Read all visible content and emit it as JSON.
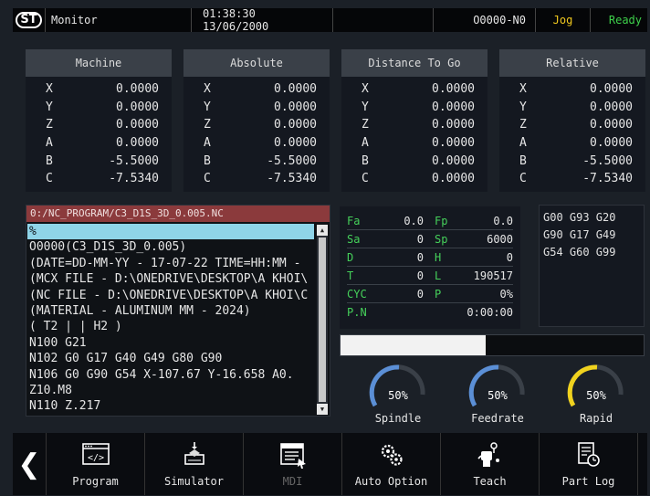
{
  "topbar": {
    "logo": "ST",
    "title": "Monitor",
    "datetime": "01:38:30 13/06/2000",
    "program_no": "O0000-N0",
    "mode": "Jog",
    "status": "Ready"
  },
  "coords": [
    {
      "title": "Machine",
      "rows": [
        [
          "X",
          "0.0000"
        ],
        [
          "Y",
          "0.0000"
        ],
        [
          "Z",
          "0.0000"
        ],
        [
          "A",
          "0.0000"
        ],
        [
          "B",
          "-5.5000"
        ],
        [
          "C",
          "-7.5340"
        ]
      ]
    },
    {
      "title": "Absolute",
      "rows": [
        [
          "X",
          "0.0000"
        ],
        [
          "Y",
          "0.0000"
        ],
        [
          "Z",
          "0.0000"
        ],
        [
          "A",
          "0.0000"
        ],
        [
          "B",
          "-5.5000"
        ],
        [
          "C",
          "-7.5340"
        ]
      ]
    },
    {
      "title": "Distance To Go",
      "rows": [
        [
          "X",
          "0.0000"
        ],
        [
          "Y",
          "0.0000"
        ],
        [
          "Z",
          "0.0000"
        ],
        [
          "A",
          "0.0000"
        ],
        [
          "B",
          "0.0000"
        ],
        [
          "C",
          "0.0000"
        ]
      ]
    },
    {
      "title": "Relative",
      "rows": [
        [
          "X",
          "0.0000"
        ],
        [
          "Y",
          "0.0000"
        ],
        [
          "Z",
          "0.0000"
        ],
        [
          "A",
          "0.0000"
        ],
        [
          "B",
          "-5.5000"
        ],
        [
          "C",
          "-7.5340"
        ]
      ]
    }
  ],
  "program": {
    "path": "0:/NC_PROGRAM/C3_D1S_3D_0.005.NC",
    "lines": [
      "%",
      "O0000(C3_D1S_3D_0.005)",
      "(DATE=DD-MM-YY - 17-07-22 TIME=HH:MM -",
      "(MCX FILE - D:\\ONEDRIVE\\DESKTOP\\A KHOI\\",
      "(NC FILE - D:\\ONEDRIVE\\DESKTOP\\A KHOI\\C",
      "(MATERIAL - ALUMINUM MM - 2024)",
      "( T2 | | H2 )",
      "N100 G21",
      "N102 G0 G17 G40 G49 G80 G90",
      "N106 G0 G90 G54 X-107.67 Y-16.658 A0.",
      "Z10.M8",
      "N110 Z.217"
    ]
  },
  "feed": {
    "rows": [
      {
        "k": "Fa",
        "v": "0.0",
        "k2": "Fp",
        "v2": "0.0"
      },
      {
        "k": "Sa",
        "v": "0",
        "k2": "Sp",
        "v2": "6000"
      },
      {
        "k": "D",
        "v": "0",
        "k2": "H",
        "v2": "0"
      },
      {
        "k": "T",
        "v": "0",
        "k2": "L",
        "v2": "190517"
      },
      {
        "k": "CYC",
        "v": "0",
        "k2": "P",
        "v2": "0%"
      }
    ],
    "pn_label": "P.N",
    "pn_value": "0:00:00"
  },
  "modal": {
    "lines": [
      "G00 G93 G20",
      "G90 G17 G49",
      "G54 G60 G99"
    ]
  },
  "progress_fraction": 0.48,
  "gauges": [
    {
      "label": "Spindle",
      "value": "50%",
      "color": "#5b8fd6"
    },
    {
      "label": "Feedrate",
      "value": "50%",
      "color": "#5b8fd6"
    },
    {
      "label": "Rapid",
      "value": "50%",
      "color": "#f0d21e"
    }
  ],
  "toolbar": {
    "back_icon": "chevron-left-icon",
    "items": [
      {
        "label": "Program",
        "icon": "code-window-icon",
        "disabled": false
      },
      {
        "label": "Simulator",
        "icon": "3d-print-icon",
        "disabled": false
      },
      {
        "label": "MDI",
        "icon": "document-window-icon",
        "disabled": true
      },
      {
        "label": "Auto Option",
        "icon": "gears-icon",
        "disabled": false
      },
      {
        "label": "Teach",
        "icon": "robot-hand-icon",
        "disabled": false
      },
      {
        "label": "Part Log",
        "icon": "clock-document-icon",
        "disabled": false
      }
    ]
  }
}
